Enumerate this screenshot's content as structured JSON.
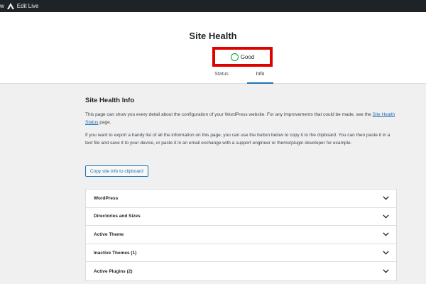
{
  "admin_bar": {
    "first_item": "w",
    "edit_label": "Edit Live"
  },
  "header": {
    "title": "Site Health",
    "status": "Good",
    "tabs": [
      {
        "label": "Status",
        "active": false
      },
      {
        "label": "Info",
        "active": true
      }
    ]
  },
  "main": {
    "heading": "Site Health Info",
    "para1_before": "This page can show you every detail about the configuration of your WordPress website. For any improvements that could be made, see the ",
    "para1_link": "Site Health Status",
    "para1_after": " page.",
    "para2": "If you want to export a handy list of all the information on this page, you can use the button below to copy it to the clipboard. You can then paste it in a text file and save it to your device, or paste it in an email exchange with a support engineer or theme/plugin developer for example.",
    "copy_button": "Copy site info to clipboard"
  },
  "sections": [
    {
      "label": "WordPress"
    },
    {
      "label": "Directories and Sizes"
    },
    {
      "label": "Active Theme"
    },
    {
      "label": "Inactive Themes (1)"
    },
    {
      "label": "Active Plugins (2)"
    }
  ],
  "colors": {
    "admin_bar": "#1d2327",
    "accent": "#2271b1",
    "good_status": "#00a32a",
    "highlight_box": "#e00000"
  },
  "icons": {
    "logo": "astra-logo-icon",
    "status": "status-circle-icon",
    "expand": "chevron-down-icon"
  }
}
